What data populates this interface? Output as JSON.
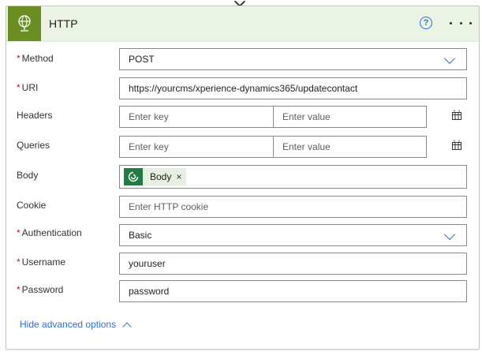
{
  "header": {
    "title": "HTTP",
    "icon": "globe-icon",
    "accent_color": "#6a8e23",
    "help_label": "?",
    "more_label": "more-options"
  },
  "fields": {
    "method": {
      "label": "Method",
      "required": "*",
      "value": "POST"
    },
    "uri": {
      "label": "URI",
      "required": "*",
      "value": "https://yourcms/xperience-dynamics365/updatecontact"
    },
    "headers": {
      "label": "Headers",
      "key_placeholder": "Enter key",
      "value_placeholder": "Enter value"
    },
    "queries": {
      "label": "Queries",
      "key_placeholder": "Enter key",
      "value_placeholder": "Enter value"
    },
    "body": {
      "label": "Body",
      "token_label": "Body",
      "token_remove": "×"
    },
    "cookie": {
      "label": "Cookie",
      "placeholder": "Enter HTTP cookie"
    },
    "authentication": {
      "label": "Authentication",
      "required": "*",
      "value": "Basic"
    },
    "username": {
      "label": "Username",
      "required": "*",
      "value": "youruser"
    },
    "password": {
      "label": "Password",
      "required": "*",
      "value": "password"
    }
  },
  "footer": {
    "advanced_link": "Hide advanced options"
  }
}
